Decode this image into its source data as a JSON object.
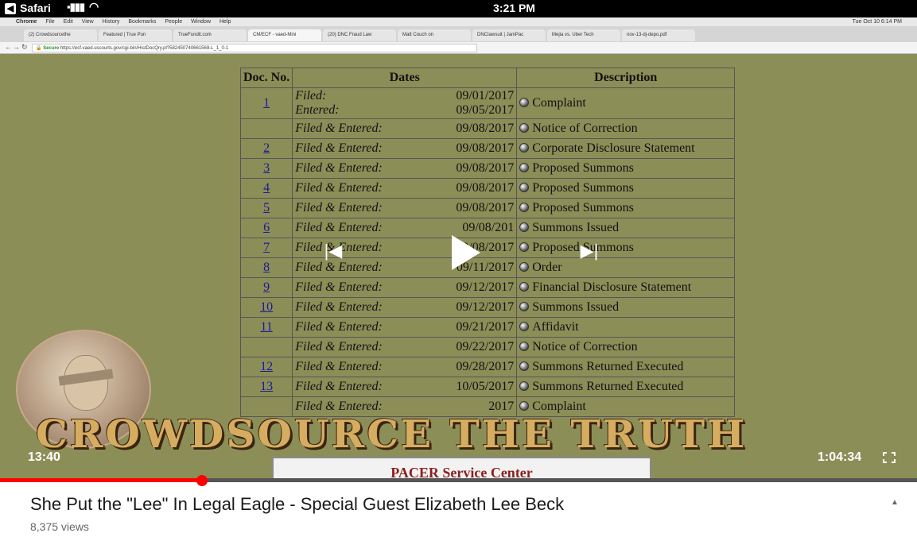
{
  "status_bar": {
    "back_glyph": "◀",
    "app_label": "Safari",
    "signal": "▪▮▮▮",
    "wifi": "◠",
    "time": "3:21 PM"
  },
  "recorded_screen": {
    "mac_menu": [
      "Chrome",
      "File",
      "Edit",
      "View",
      "History",
      "Bookmarks",
      "People",
      "Window",
      "Help"
    ],
    "mac_clock": "Tue Oct 10  6:14 PM",
    "tabs": [
      "(2) Crowdsourcethe",
      "Featured | True Pun",
      "TrueFundit.com",
      "CM/ECF - vaed-Mini",
      "(20) DNC Fraud Law",
      "Matt Couch on",
      "DNCIawsuit | JamPac",
      "Mejia vs. Uber Tech",
      "nov-13-dj-depo.pdf"
    ],
    "address": {
      "secure": "Secure",
      "url": "https://ecf.vaed.uscourts.gov/cgi-bin/HistDocQry.pl?582450740661569-L_1_0-1"
    },
    "docket": {
      "headers": [
        "Doc. No.",
        "Dates",
        "Description"
      ],
      "rows": [
        {
          "num": "1",
          "dates": [
            {
              "label": "Filed:",
              "date": "09/01/2017"
            },
            {
              "label": "Entered:",
              "date": "09/05/2017"
            }
          ],
          "desc": "Complaint"
        },
        {
          "num": "",
          "dates": [
            {
              "label": "Filed & Entered:",
              "date": "09/08/2017"
            }
          ],
          "desc": "Notice of Correction"
        },
        {
          "num": "2",
          "dates": [
            {
              "label": "Filed & Entered:",
              "date": "09/08/2017"
            }
          ],
          "desc": "Corporate Disclosure Statement"
        },
        {
          "num": "3",
          "dates": [
            {
              "label": "Filed & Entered:",
              "date": "09/08/2017"
            }
          ],
          "desc": "Proposed Summons"
        },
        {
          "num": "4",
          "dates": [
            {
              "label": "Filed & Entered:",
              "date": "09/08/2017"
            }
          ],
          "desc": "Proposed Summons"
        },
        {
          "num": "5",
          "dates": [
            {
              "label": "Filed & Entered:",
              "date": "09/08/2017"
            }
          ],
          "desc": "Proposed Summons"
        },
        {
          "num": "6",
          "dates": [
            {
              "label": "Filed & Entered:",
              "date": "09/08/201"
            }
          ],
          "desc": "Summons Issued"
        },
        {
          "num": "7",
          "dates": [
            {
              "label": "Filed & Entered:",
              "date": "09/08/2017"
            }
          ],
          "desc": "Proposed Summons"
        },
        {
          "num": "8",
          "dates": [
            {
              "label": "Filed & Entered:",
              "date": "09/11/2017"
            }
          ],
          "desc": "Order"
        },
        {
          "num": "9",
          "dates": [
            {
              "label": "Filed & Entered:",
              "date": "09/12/2017"
            }
          ],
          "desc": "Financial Disclosure Statement"
        },
        {
          "num": "10",
          "dates": [
            {
              "label": "Filed & Entered:",
              "date": "09/12/2017"
            }
          ],
          "desc": "Summons Issued"
        },
        {
          "num": "11",
          "dates": [
            {
              "label": "Filed & Entered:",
              "date": "09/21/2017"
            }
          ],
          "desc": "Affidavit"
        },
        {
          "num": "",
          "dates": [
            {
              "label": "Filed & Entered:",
              "date": "09/22/2017"
            }
          ],
          "desc": "Notice of Correction"
        },
        {
          "num": "12",
          "dates": [
            {
              "label": "Filed & Entered:",
              "date": "09/28/2017"
            }
          ],
          "desc": "Summons Returned Executed"
        },
        {
          "num": "13",
          "dates": [
            {
              "label": "Filed & Entered:",
              "date": "10/05/2017"
            }
          ],
          "desc": "Summons Returned Executed"
        },
        {
          "num": "",
          "dates": [
            {
              "label": "Filed & Entered:",
              "date": "2017"
            }
          ],
          "desc": "Complaint"
        }
      ]
    },
    "pacer_banner": "PACER Service Center"
  },
  "brand_overlay": "CROWDSOURCE THE TRUTH",
  "player": {
    "current_time": "13:40",
    "duration": "1:04:34",
    "progress_fraction": 0.22,
    "prev_icon": "skip-previous-icon",
    "play_icon": "play-icon",
    "next_icon": "skip-next-icon",
    "fullscreen_icon": "fullscreen-icon"
  },
  "video_info": {
    "title": "She Put the \"Lee\" In Legal Eagle - Special Guest Elizabeth Lee Beck",
    "views": "8,375 views",
    "expand_icon": "chevron-up-icon"
  },
  "colors": {
    "video_bg": "#8c8e58",
    "progress": "#ff0000",
    "link": "#1a1a9a",
    "brand_gold": "#d6ad60"
  }
}
